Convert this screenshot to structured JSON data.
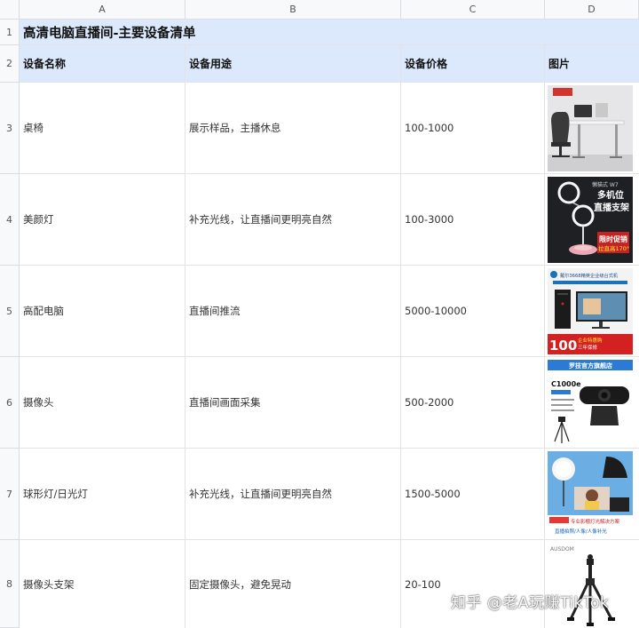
{
  "columns": [
    "A",
    "B",
    "C",
    "D"
  ],
  "row_numbers": [
    "1",
    "2",
    "3",
    "4",
    "5",
    "6",
    "7",
    "8"
  ],
  "title": "高清电脑直播间-主要设备清单",
  "headers": {
    "name": "设备名称",
    "purpose": "设备用途",
    "price": "设备价格",
    "image": "图片"
  },
  "rows": [
    {
      "name": "桌椅",
      "purpose": "展示样品，主播休息",
      "price": "100-1000",
      "image_icon": "desk-chair-photo"
    },
    {
      "name": "美颜灯",
      "purpose": "补充光线，让直播间更明亮自然",
      "price": "100-3000",
      "image_icon": "ring-light-photo",
      "image_text": {
        "brand": "懒猫式 W7",
        "line1": "多机位",
        "line2": "直播支架",
        "line3": "限时促销",
        "line4": "拉直高170°"
      }
    },
    {
      "name": "高配电脑",
      "purpose": "直播间推流",
      "price": "5000-10000",
      "image_icon": "desktop-pc-photo",
      "image_text": {
        "line1": "戴尔3668精英企业级台式机",
        "big": "100",
        "line2": "企业特惠购",
        "line3": "三年保修"
      }
    },
    {
      "name": "摄像头",
      "purpose": "直播间画面采集",
      "price": "500-2000",
      "image_icon": "webcam-photo",
      "image_text": {
        "store": "罗技官方旗舰店",
        "model": "C1000e"
      }
    },
    {
      "name": "球形灯/日光灯",
      "purpose": "补充光线，让直播间更明亮自然",
      "price": "1500-5000",
      "image_icon": "ball-light-photo",
      "image_text": {
        "line1": "专业影棚灯光解决方案",
        "line2": "直播拍照/人像/人像补光"
      }
    },
    {
      "name": "摄像头支架",
      "purpose": "固定摄像头，避免晃动",
      "price": "20-100",
      "image_icon": "tripod-photo",
      "image_text": {
        "brand": "AUSDOM"
      }
    }
  ],
  "watermark": "知乎 @老A玩赚TikTok"
}
